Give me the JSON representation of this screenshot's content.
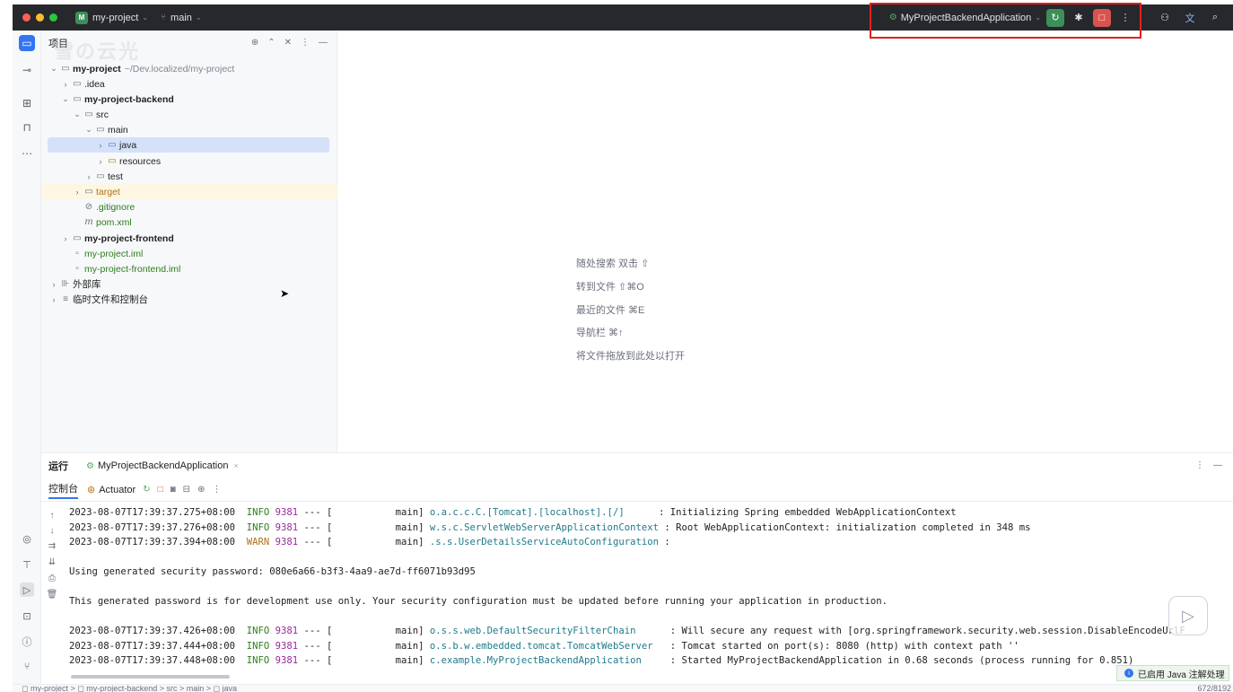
{
  "titlebar": {
    "project_badge": "M",
    "project_name": "my-project",
    "branch": "main",
    "run_config": "MyProjectBackendApplication"
  },
  "project_panel": {
    "title": "项目",
    "watermark": "雪の云光"
  },
  "tree": [
    {
      "label": "my-project",
      "path": "~/Dev.localized/my-project"
    },
    {
      "label": ".idea"
    },
    {
      "label": "my-project-backend"
    },
    {
      "label": "src"
    },
    {
      "label": "main"
    },
    {
      "label": "java"
    },
    {
      "label": "resources"
    },
    {
      "label": "test"
    },
    {
      "label": "target"
    },
    {
      "label": ".gitignore"
    },
    {
      "label": "pom.xml"
    },
    {
      "label": "my-project-frontend"
    },
    {
      "label": "my-project.iml"
    },
    {
      "label": "my-project-frontend.iml"
    },
    {
      "label": "外部库"
    },
    {
      "label": "临时文件和控制台"
    }
  ],
  "editor_hints": [
    "随处搜索 双击 ⇧",
    "转到文件 ⇧⌘O",
    "最近的文件 ⌘E",
    "导航栏 ⌘↑",
    "将文件拖放到此处以打开"
  ],
  "run_panel": {
    "label": "运行",
    "tab": "MyProjectBackendApplication",
    "console_tab": "控制台",
    "actuator": "Actuator"
  },
  "console": {
    "lines": [
      {
        "ts": "2023-08-07T17:39:37.275+08:00",
        "level": "INFO",
        "pid": "9381",
        "sep": "--- [",
        "thread": "main]",
        "cls": "o.a.c.c.C.[Tomcat].[localhost].[/]     ",
        "msg": ": Initializing Spring embedded WebApplicationContext"
      },
      {
        "ts": "2023-08-07T17:39:37.276+08:00",
        "level": "INFO",
        "pid": "9381",
        "sep": "--- [",
        "thread": "main]",
        "cls": "w.s.c.ServletWebServerApplicationContext",
        "msg": ": Root WebApplicationContext: initialization completed in 348 ms"
      },
      {
        "ts": "2023-08-07T17:39:37.394+08:00",
        "level": "WARN",
        "pid": "9381",
        "sep": "--- [",
        "thread": "main]",
        "cls": ".s.s.UserDetailsServiceAutoConfiguration",
        "msg": ":"
      },
      {
        "text": "Using generated security password: 080e6a66-b3f3-4aa9-ae7d-ff6071b93d95"
      },
      {
        "text": "This generated password is for development use only. Your security configuration must be updated before running your application in production."
      },
      {
        "ts": "2023-08-07T17:39:37.426+08:00",
        "level": "INFO",
        "pid": "9381",
        "sep": "--- [",
        "thread": "main]",
        "cls": "o.s.s.web.DefaultSecurityFilterChain     ",
        "msg": ": Will secure any request with [org.springframework.security.web.session.DisableEncodeUrlF"
      },
      {
        "ts": "2023-08-07T17:39:37.444+08:00",
        "level": "INFO",
        "pid": "9381",
        "sep": "--- [",
        "thread": "main]",
        "cls": "o.s.b.w.embedded.tomcat.TomcatWebServer  ",
        "msg": ": Tomcat started on port(s): 8080 (http) with context path ''"
      },
      {
        "ts": "2023-08-07T17:39:37.448+08:00",
        "level": "INFO",
        "pid": "9381",
        "sep": "--- [",
        "thread": "main]",
        "cls": "c.example.MyProjectBackendApplication    ",
        "msg": ": Started MyProjectBackendApplication in 0.68 seconds (process running for 0.851)"
      }
    ]
  },
  "statusbar": {
    "breadcrumb": "◻ my-project  >  ◻ my-project-backend  >  src  >  main  >  ◻ java",
    "position": "672/8192"
  },
  "notification": "已启用 Java 注解处理"
}
